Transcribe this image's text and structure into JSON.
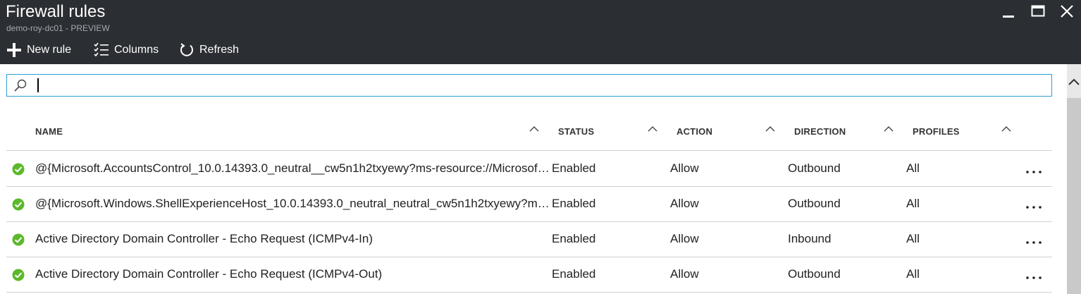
{
  "header": {
    "title": "Firewall rules",
    "subtitle": "demo-roy-dc01 - PREVIEW"
  },
  "toolbar": {
    "new_rule_label": "New rule",
    "columns_label": "Columns",
    "refresh_label": "Refresh"
  },
  "search": {
    "value": "",
    "placeholder": ""
  },
  "table": {
    "columns": [
      "NAME",
      "STATUS",
      "ACTION",
      "DIRECTION",
      "PROFILES"
    ],
    "rows": [
      {
        "name": "@{Microsoft.AccountsControl_10.0.14393.0_neutral__cw5n1h2txyewy?ms-resource://Microsoft.AccountsControl/Resources/DisplayName}",
        "status": "Enabled",
        "action": "Allow",
        "direction": "Outbound",
        "profiles": "All"
      },
      {
        "name": "@{Microsoft.Windows.ShellExperienceHost_10.0.14393.0_neutral_neutral_cw5n1h2txyewy?ms-resource://Microsoft.Windows.ShellExperienceHost/resources/PkgDisplayName}",
        "status": "Enabled",
        "action": "Allow",
        "direction": "Outbound",
        "profiles": "All"
      },
      {
        "name": "Active Directory Domain Controller - Echo Request (ICMPv4-In)",
        "status": "Enabled",
        "action": "Allow",
        "direction": "Inbound",
        "profiles": "All"
      },
      {
        "name": "Active Directory Domain Controller - Echo Request (ICMPv4-Out)",
        "status": "Enabled",
        "action": "Allow",
        "direction": "Outbound",
        "profiles": "All"
      }
    ]
  },
  "colors": {
    "header_bg": "#2b2e32",
    "accent": "#2a9fd8",
    "enabled_green": "#5cb82c"
  },
  "icons": {
    "new_rule": "plus-icon",
    "columns": "checklist-icon",
    "refresh": "refresh-icon",
    "search": "search-icon",
    "status": "check-circle-icon",
    "row_menu": "ellipsis-icon",
    "sort": "chevron-up-icon"
  }
}
